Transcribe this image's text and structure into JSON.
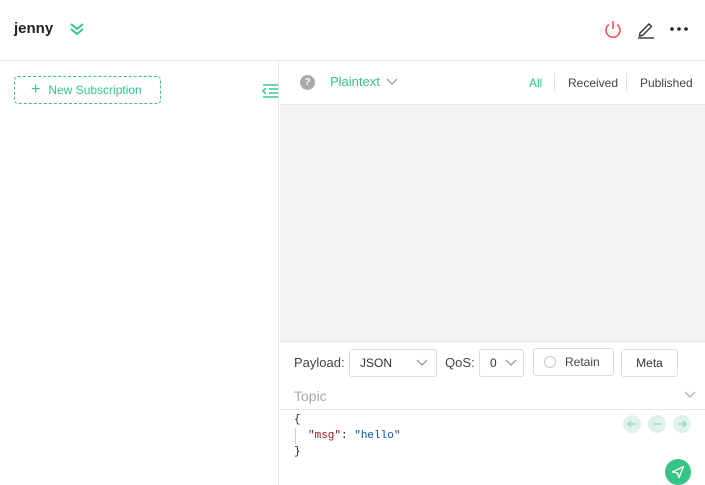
{
  "header": {
    "connection_name": "jenny"
  },
  "sidebar": {
    "new_subscription_label": "New Subscription"
  },
  "messages": {
    "format": "Plaintext",
    "filters": [
      "All",
      "Received",
      "Published"
    ],
    "active_filter": "All"
  },
  "composer": {
    "payload_label": "Payload:",
    "payload_format": "JSON",
    "qos_label": "QoS:",
    "qos_value": "0",
    "retain_label": "Retain",
    "meta_label": "Meta",
    "topic_placeholder": "Topic",
    "payload_lines": {
      "open": "{",
      "key": "\"msg\"",
      "colon": ": ",
      "value": "\"hello\"",
      "close": "}"
    }
  },
  "colors": {
    "accent": "#34c388",
    "danger": "#f25353",
    "message_area_bg": "#f3f4f6"
  }
}
